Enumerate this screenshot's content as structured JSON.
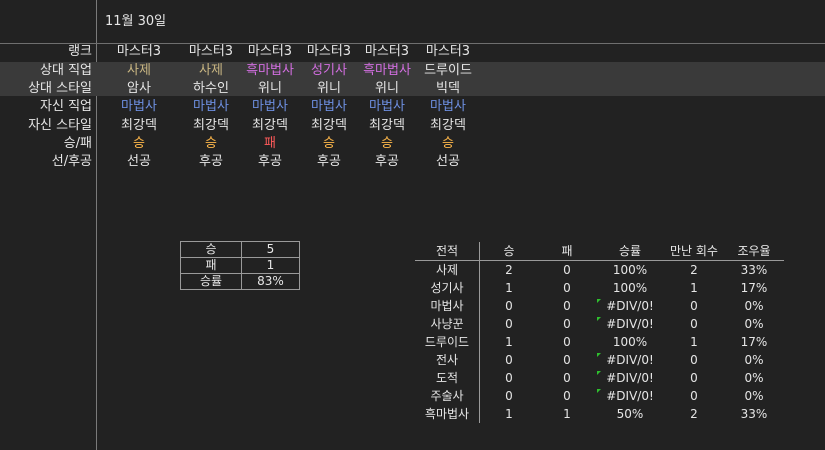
{
  "date": "11월 30일",
  "row_labels": [
    "랭크",
    "상대 직업",
    "상대 스타일",
    "자신 직업",
    "자신 스타일",
    "승/패",
    "선/후공"
  ],
  "games": [
    {
      "rank": "마스터3",
      "opp_class": "사제",
      "opp_style": "암사",
      "my_class": "마법사",
      "my_style": "최강덱",
      "result": "승",
      "turn": "선공"
    },
    {
      "rank": "마스터3",
      "opp_class": "사제",
      "opp_style": "하수인",
      "my_class": "마법사",
      "my_style": "최강덱",
      "result": "승",
      "turn": "후공"
    },
    {
      "rank": "마스터3",
      "opp_class": "흑마법사",
      "opp_style": "위니",
      "my_class": "마법사",
      "my_style": "최강덱",
      "result": "패",
      "turn": "후공"
    },
    {
      "rank": "마스터3",
      "opp_class": "성기사",
      "opp_style": "위니",
      "my_class": "마법사",
      "my_style": "최강덱",
      "result": "승",
      "turn": "후공"
    },
    {
      "rank": "마스터3",
      "opp_class": "흑마법사",
      "opp_style": "위니",
      "my_class": "마법사",
      "my_style": "최강덱",
      "result": "승",
      "turn": "후공"
    },
    {
      "rank": "마스터3",
      "opp_class": "드루이드",
      "opp_style": "빅덱",
      "my_class": "마법사",
      "my_style": "최강덱",
      "result": "승",
      "turn": "선공"
    }
  ],
  "summary": [
    {
      "key": "승",
      "value": "5"
    },
    {
      "key": "패",
      "value": "1"
    },
    {
      "key": "승률",
      "value": "83%"
    }
  ],
  "stats": {
    "headers": [
      "전적",
      "승",
      "패",
      "승률",
      "만난 회수",
      "조우율"
    ],
    "rows": [
      [
        "사제",
        "2",
        "0",
        "100%",
        "2",
        "33%"
      ],
      [
        "성기사",
        "1",
        "0",
        "100%",
        "1",
        "17%"
      ],
      [
        "마법사",
        "0",
        "0",
        "#DIV/0!",
        "0",
        "0%"
      ],
      [
        "사냥꾼",
        "0",
        "0",
        "#DIV/0!",
        "0",
        "0%"
      ],
      [
        "드루이드",
        "1",
        "0",
        "100%",
        "1",
        "17%"
      ],
      [
        "전사",
        "0",
        "0",
        "#DIV/0!",
        "0",
        "0%"
      ],
      [
        "도적",
        "0",
        "0",
        "#DIV/0!",
        "0",
        "0%"
      ],
      [
        "주술사",
        "0",
        "0",
        "#DIV/0!",
        "0",
        "0%"
      ],
      [
        "흑마법사",
        "1",
        "1",
        "50%",
        "2",
        "33%"
      ]
    ]
  },
  "colors": {
    "background": "#222222",
    "text": "#e6e6e6",
    "class_sage": "#c9b682",
    "class_purple": "#d26ee0",
    "class_blue": "#6d8fe0",
    "win": "#ffb84a",
    "loss": "#ff5a5a",
    "error_flag": "#2ec02e"
  }
}
